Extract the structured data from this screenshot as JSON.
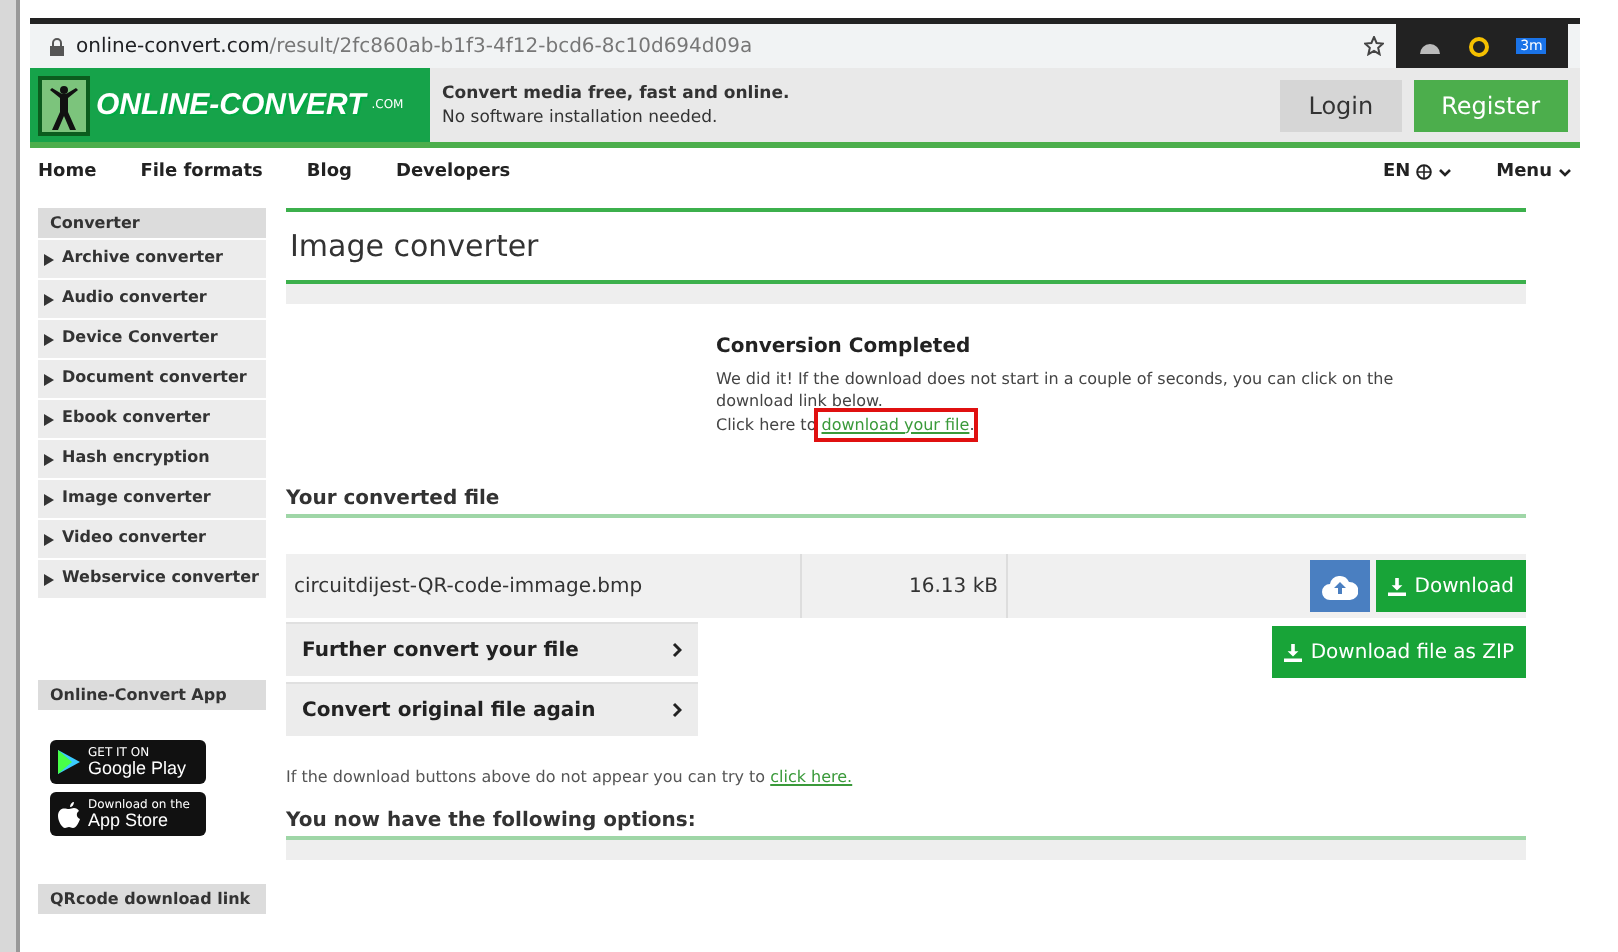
{
  "browser": {
    "url_host": "online-convert.com",
    "url_path": "/result/2fc860ab-b1f3-4f12-bcd6-8c10d694d09a",
    "badge": "3m"
  },
  "header": {
    "logo": "ONLINE-CONVERT",
    "logo_suffix": ".COM",
    "tagline": "Convert media free, fast and online.",
    "subline": "No software installation needed.",
    "buttons": [
      {
        "label": "Login",
        "kind": "plain"
      },
      {
        "label": "Register",
        "kind": "primary"
      }
    ]
  },
  "nav": {
    "items": [
      "Home",
      "File formats",
      "Blog",
      "Developers"
    ],
    "language": "EN",
    "menu": "Menu"
  },
  "sidebar": {
    "title": "Converter",
    "items": [
      "Archive converter",
      "Audio converter",
      "Device Converter",
      "Document converter",
      "Ebook converter",
      "Hash encryption",
      "Image converter",
      "Video converter",
      "Webservice converter"
    ],
    "app_title": "Online-Convert App",
    "stores": [
      {
        "kind": "google",
        "small": "GET IT ON",
        "big": "Google Play"
      },
      {
        "kind": "apple",
        "small": "Download on the",
        "big": "App Store"
      }
    ],
    "qr_title": "QRcode download link"
  },
  "main": {
    "title": "Image converter",
    "completed_title": "Conversion Completed",
    "completed_text": "We did it! If the download does not start in a couple of seconds, you can click on the download link below.",
    "click_prefix": "Click here to ",
    "click_link": "download your file",
    "click_suffix": ".",
    "converted_heading": "Your converted file",
    "file": {
      "name": "circuitdijest-QR-code-immage.bmp",
      "size": "16.13 kB",
      "download": "Download",
      "zip": "Download file as ZIP"
    },
    "actions": [
      "Further convert your file",
      "Convert original file again"
    ],
    "fallback_text": "If the download buttons above do not appear you can try to ",
    "fallback_link": "click here.",
    "options_heading": "You now have the following options:"
  }
}
